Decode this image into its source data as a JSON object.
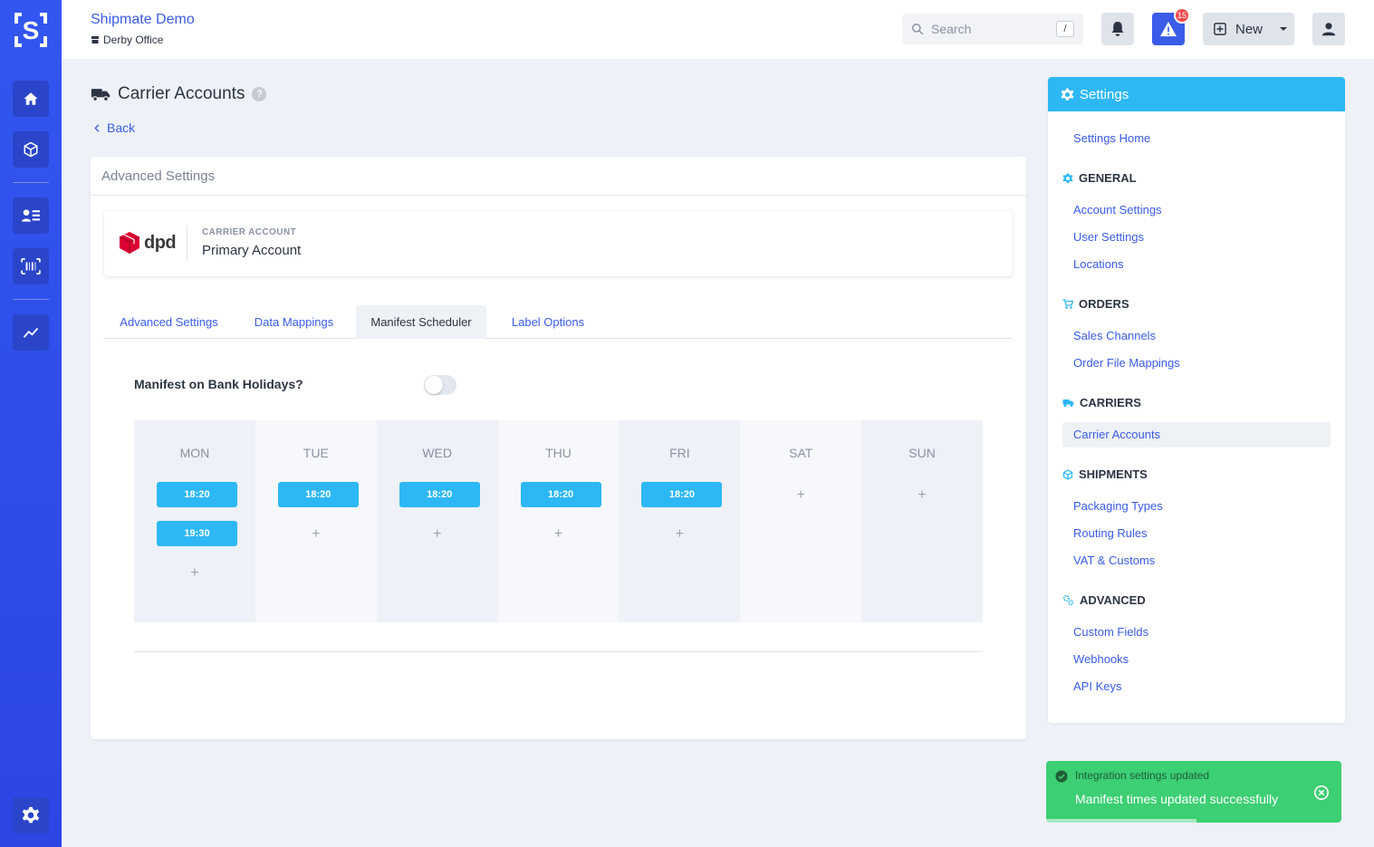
{
  "header": {
    "org_name": "Shipmate Demo",
    "location": "Derby Office",
    "search_placeholder": "Search",
    "search_shortcut": "/",
    "alert_count": "15",
    "new_label": "New"
  },
  "page": {
    "title": "Carrier Accounts",
    "back_label": "Back"
  },
  "card": {
    "header": "Advanced Settings",
    "carrier_logo_text": "dpd",
    "account_label": "CARRIER ACCOUNT",
    "account_name": "Primary Account",
    "tabs": [
      {
        "label": "Advanced Settings"
      },
      {
        "label": "Data Mappings"
      },
      {
        "label": "Manifest Scheduler"
      },
      {
        "label": "Label Options"
      }
    ],
    "active_tab": "Manifest Scheduler",
    "bank_holidays_label": "Manifest on Bank Holidays?",
    "bank_holidays_enabled": false,
    "days": [
      {
        "name": "MON",
        "times": [
          "18:20",
          "19:30"
        ]
      },
      {
        "name": "TUE",
        "times": [
          "18:20"
        ]
      },
      {
        "name": "WED",
        "times": [
          "18:20"
        ]
      },
      {
        "name": "THU",
        "times": [
          "18:20"
        ]
      },
      {
        "name": "FRI",
        "times": [
          "18:20"
        ]
      },
      {
        "name": "SAT",
        "times": []
      },
      {
        "name": "SUN",
        "times": []
      }
    ],
    "add_glyph": "+"
  },
  "settings": {
    "title": "Settings",
    "home": "Settings Home",
    "sections": [
      {
        "title": "GENERAL",
        "items": [
          "Account Settings",
          "User Settings",
          "Locations"
        ]
      },
      {
        "title": "ORDERS",
        "items": [
          "Sales Channels",
          "Order File Mappings"
        ]
      },
      {
        "title": "CARRIERS",
        "items": [
          "Carrier Accounts"
        ]
      },
      {
        "title": "SHIPMENTS",
        "items": [
          "Packaging Types",
          "Routing Rules",
          "VAT & Customs"
        ]
      },
      {
        "title": "ADVANCED",
        "items": [
          "Custom Fields",
          "Webhooks",
          "API Keys"
        ]
      }
    ],
    "active_item": "Carrier Accounts"
  },
  "toast": {
    "title": "Integration settings updated",
    "message": "Manifest times updated successfully",
    "progress": 0.51
  },
  "colors": {
    "rail": "#3356f0",
    "accent": "#3a5ce8",
    "slot": "#2db8f5",
    "toast": "#3ccf73",
    "badge": "#f24b4b"
  }
}
